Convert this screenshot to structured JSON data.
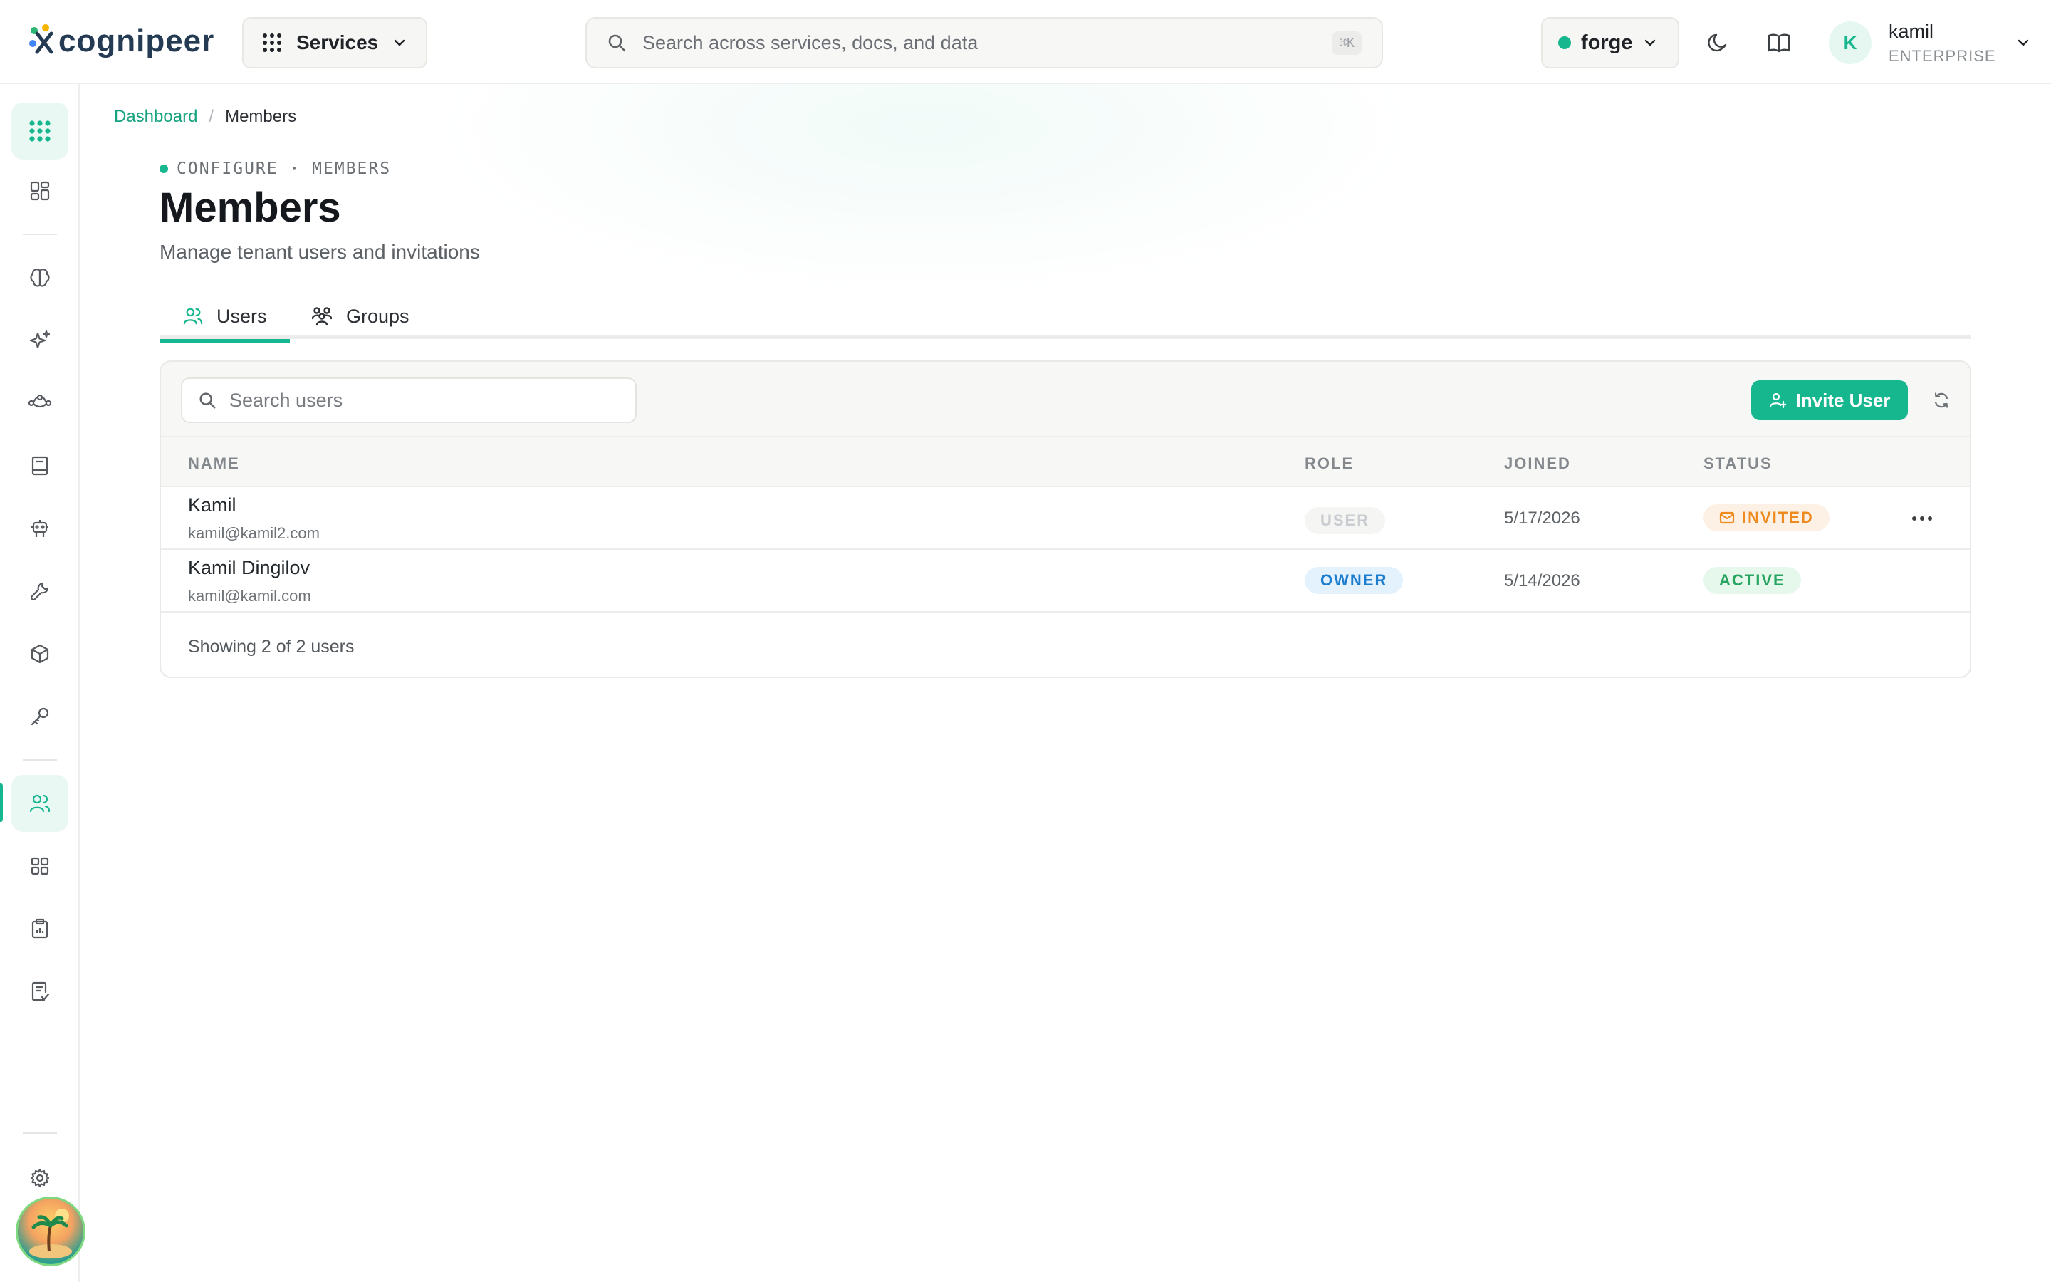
{
  "colors": {
    "accent": "#16b68e",
    "owner": "#1d7ecf",
    "invited": "#ee8a1e",
    "active": "#27a560"
  },
  "topbar": {
    "logo_text": "cognipeer",
    "services_label": "Services",
    "search_placeholder": "Search across services, docs, and data",
    "search_shortcut": "⌘K",
    "tenant_label": "forge",
    "user": {
      "initial": "K",
      "name": "kamil",
      "plan": "ENTERPRISE"
    }
  },
  "sidebar": {
    "items": [
      {
        "icon": "apps-grid-icon"
      },
      {
        "icon": "dashboard-icon"
      },
      {
        "icon": "brain-icon"
      },
      {
        "icon": "sparkles-icon"
      },
      {
        "icon": "flow-icon"
      },
      {
        "icon": "book-icon"
      },
      {
        "icon": "robot-icon"
      },
      {
        "icon": "wrench-icon"
      },
      {
        "icon": "cube-icon"
      },
      {
        "icon": "key-icon"
      },
      {
        "icon": "users-icon",
        "active": true
      },
      {
        "icon": "modules-icon"
      },
      {
        "icon": "clipboard-icon"
      },
      {
        "icon": "checklist-icon"
      },
      {
        "icon": "gear-icon"
      }
    ]
  },
  "breadcrumb": {
    "parent": "Dashboard",
    "separator": "/",
    "current": "Members"
  },
  "header": {
    "eyebrow": "CONFIGURE · MEMBERS",
    "title": "Members",
    "subtitle": "Manage tenant users and invitations"
  },
  "tabs": [
    {
      "label": "Users",
      "active": true
    },
    {
      "label": "Groups",
      "active": false
    }
  ],
  "table": {
    "search_placeholder": "Search users",
    "invite_label": "Invite User",
    "columns": {
      "name": "NAME",
      "role": "ROLE",
      "joined": "JOINED",
      "status": "STATUS"
    },
    "rows": [
      {
        "name": "Kamil",
        "email": "kamil@kamil2.com",
        "role": "USER",
        "joined": "5/17/2026",
        "status": "INVITED"
      },
      {
        "name": "Kamil Dingilov",
        "email": "kamil@kamil.com",
        "role": "OWNER",
        "joined": "5/14/2026",
        "status": "ACTIVE"
      }
    ],
    "footer": "Showing 2 of 2 users"
  }
}
